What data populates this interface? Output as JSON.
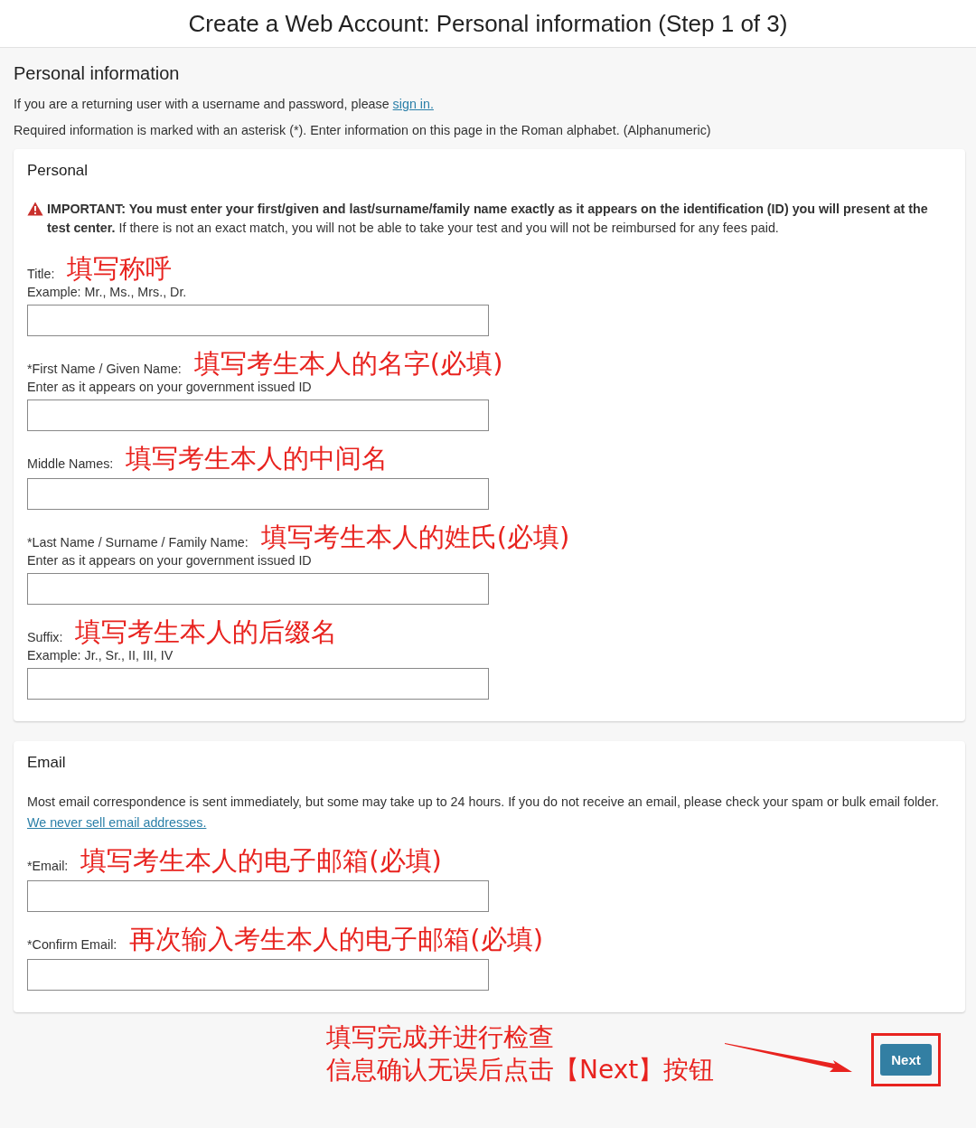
{
  "page_title": "Create a Web Account: Personal information (Step 1 of 3)",
  "section": {
    "heading": "Personal information",
    "intro": {
      "text": "If you are a returning user with a username and password, please",
      "link": "sign in."
    },
    "required_note": "Required information is marked with an asterisk (*). Enter information on this page in the Roman alphabet. (Alphanumeric)"
  },
  "cards": [
    {
      "heading": "Personal",
      "warning": "**IMPORTANT: You must enter your first/given and last/surname/family name exactly as it appears on the identification (ID) you will present at the test center.** If there is not an exact match, you will not be able to take your test and you will not be reimbursed for any fees paid.",
      "fields": [
        {
          "label": "Title:",
          "note": "填写称呼",
          "hint": "Example: Mr., Ms., Mrs., Dr."
        },
        {
          "label": "*First Name / Given Name:",
          "note": "填写考生本人的名字(必填)",
          "hint": "Enter as it appears on your government issued ID"
        },
        {
          "label": "Middle Names:",
          "note": "填写考生本人的中间名"
        },
        {
          "label": "*Last Name / Surname / Family Name:",
          "note": "填写考生本人的姓氏(必填)",
          "hint": "Enter as it appears on your government issued ID"
        },
        {
          "label": "Suffix:",
          "note": "填写考生本人的后缀名",
          "hint": "Example: Jr., Sr., II, III, IV"
        }
      ]
    },
    {
      "heading": "Email",
      "description": {
        "text": "Most email correspondence is sent immediately, but some may take up to 24 hours. If you do not receive an email, please check your spam or bulk email folder.",
        "link": "We never sell email addresses."
      },
      "fields": [
        {
          "label": "*Email:",
          "note": "填写考生本人的电子邮箱(必填)"
        },
        {
          "label": "*Confirm Email:",
          "note": "再次输入考生本人的电子邮箱(必填)"
        }
      ]
    }
  ],
  "footer": {
    "note_lines": [
      "填写完成并进行检查",
      "信息确认无误后点击【Next】按钮"
    ],
    "button": "Next"
  }
}
